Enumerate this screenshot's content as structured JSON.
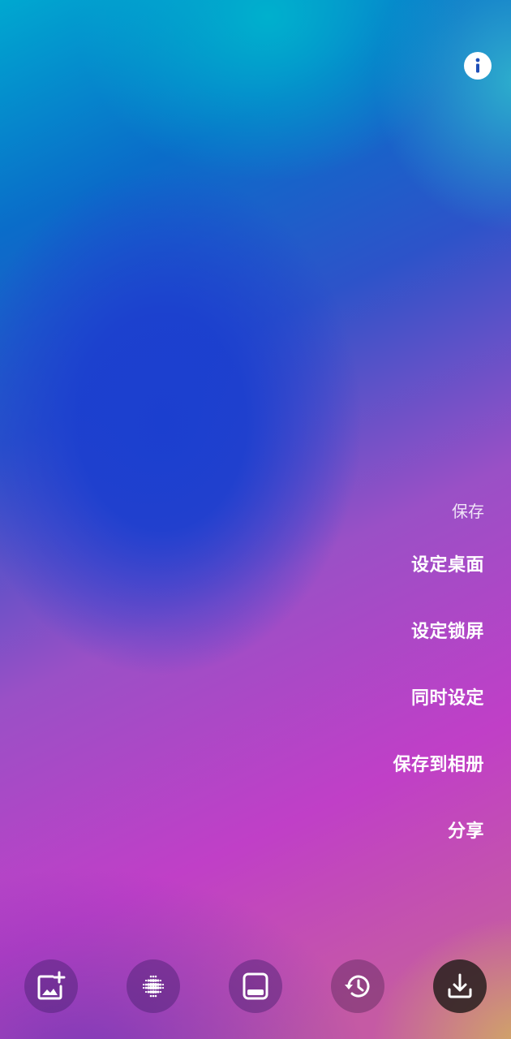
{
  "menu": {
    "header": "保存",
    "items": [
      {
        "label": "设定桌面"
      },
      {
        "label": "设定锁屏"
      },
      {
        "label": "同时设定"
      },
      {
        "label": "保存到相册"
      },
      {
        "label": "分享"
      }
    ]
  },
  "top_bar": {
    "info_icon": "info-icon"
  },
  "toolbar": {
    "buttons": [
      {
        "icon": "add-image-icon"
      },
      {
        "icon": "dot-pattern-icon"
      },
      {
        "icon": "phone-preview-icon"
      },
      {
        "icon": "history-icon"
      },
      {
        "icon": "download-icon"
      }
    ]
  },
  "colors": {
    "blue_blob": "#1b3fcf",
    "cyan_top": "#00b0cd",
    "magenta": "#c03fc7",
    "download_button_bg": "#2a1e1e"
  }
}
